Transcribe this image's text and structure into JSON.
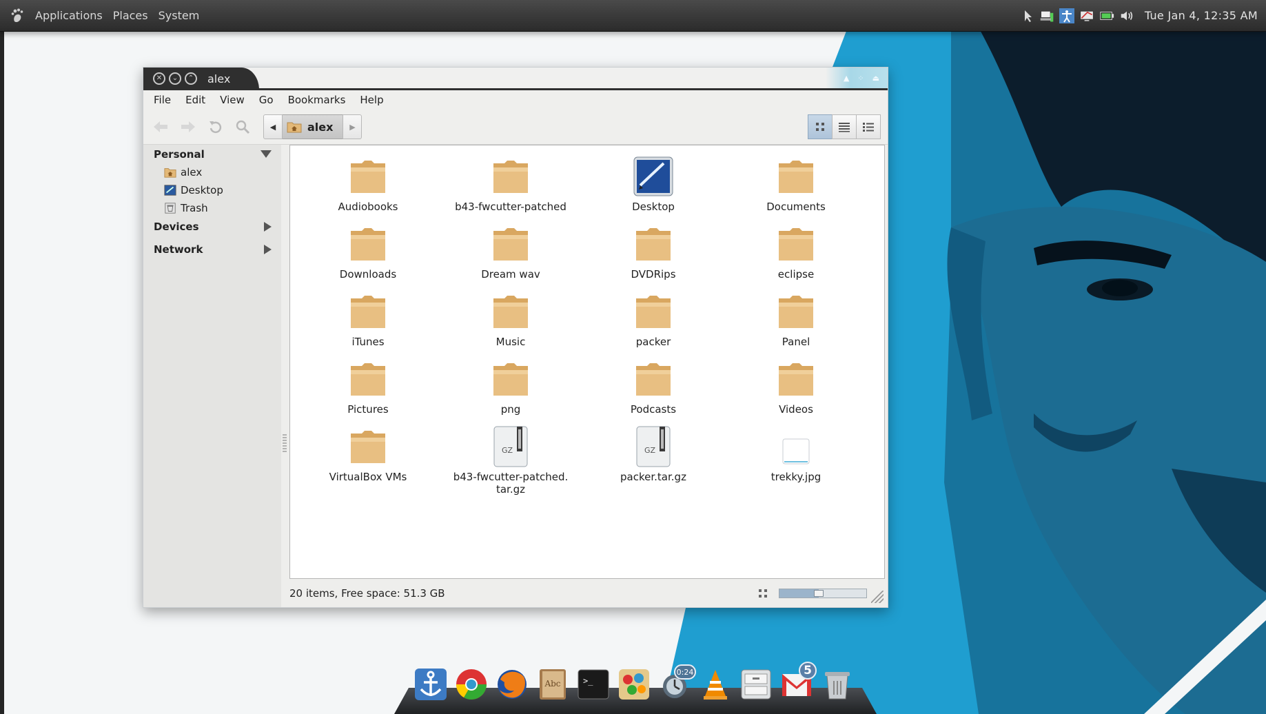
{
  "panel": {
    "menus": [
      "Applications",
      "Places",
      "System"
    ],
    "clock": "Tue Jan  4, 12:35 AM"
  },
  "window": {
    "title": "alex",
    "menubar": [
      "File",
      "Edit",
      "View",
      "Go",
      "Bookmarks",
      "Help"
    ],
    "location": "alex"
  },
  "sidebar": {
    "personal": "Personal",
    "items": [
      "alex",
      "Desktop",
      "Trash"
    ],
    "devices": "Devices",
    "network": "Network"
  },
  "files": [
    {
      "name": "Audiobooks",
      "type": "folder"
    },
    {
      "name": "b43-fwcutter-patched",
      "type": "folder"
    },
    {
      "name": "Desktop",
      "type": "desktop"
    },
    {
      "name": "Documents",
      "type": "folder"
    },
    {
      "name": "Downloads",
      "type": "folder"
    },
    {
      "name": "Dream wav",
      "type": "folder"
    },
    {
      "name": "DVDRips",
      "type": "folder"
    },
    {
      "name": "eclipse",
      "type": "folder"
    },
    {
      "name": "iTunes",
      "type": "folder"
    },
    {
      "name": "Music",
      "type": "folder"
    },
    {
      "name": "packer",
      "type": "folder"
    },
    {
      "name": "Panel",
      "type": "folder"
    },
    {
      "name": "Pictures",
      "type": "folder"
    },
    {
      "name": "png",
      "type": "folder"
    },
    {
      "name": "Podcasts",
      "type": "folder"
    },
    {
      "name": "Videos",
      "type": "folder"
    },
    {
      "name": "VirtualBox VMs",
      "type": "folder"
    },
    {
      "name": "b43-fwcutter-patched.\ntar.gz",
      "type": "archive"
    },
    {
      "name": "packer.tar.gz",
      "type": "archive"
    },
    {
      "name": "trekky.jpg",
      "type": "image"
    }
  ],
  "archive_label": "GZ",
  "status": "20 items, Free space: 51.3 GB",
  "zoom_level": 0.45,
  "dock": {
    "timer": "0:24",
    "mail_count": "5",
    "dictionary_label": "Abc",
    "terminal_prompt": ">_"
  },
  "colors": {
    "folder": "#e3b877",
    "wallpaper_blue": "#1f9ed0",
    "accent": "#a8d8e8"
  }
}
